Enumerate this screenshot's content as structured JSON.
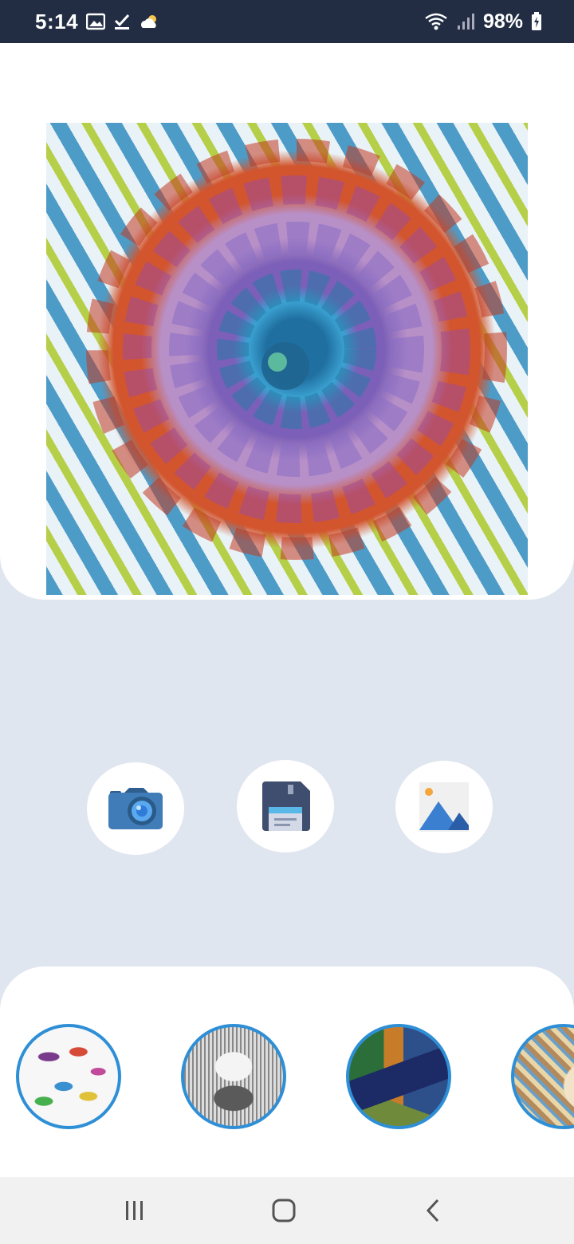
{
  "status_bar": {
    "time": "5:14",
    "battery": "98%",
    "left_icons": [
      "image-icon",
      "check-icon",
      "weather-cloud-sun-icon"
    ],
    "right_icons": [
      "wifi-icon",
      "signal-icon",
      "battery-charging-icon"
    ]
  },
  "main": {
    "artwork": {
      "icon": "stylized-flower-image"
    },
    "actions": [
      {
        "name": "camera",
        "icon": "camera-icon"
      },
      {
        "name": "save",
        "icon": "floppy-disk-icon"
      },
      {
        "name": "gallery",
        "icon": "image-gallery-icon"
      }
    ]
  },
  "styles": {
    "thumbnails": [
      {
        "icon": "watercolor-feathers-thumbnail"
      },
      {
        "icon": "pencil-cupcake-thumbnail"
      },
      {
        "icon": "cubist-painting-thumbnail"
      },
      {
        "icon": "mosaic-portrait-thumbnail"
      }
    ],
    "selected_border_color": "#2e8fd6"
  },
  "nav_bar": {
    "buttons": [
      "recent-apps-icon",
      "home-icon",
      "back-icon"
    ]
  },
  "colors": {
    "status_bar_bg": "#222d44",
    "page_bg": "#e0e6ef",
    "card_bg": "#ffffff",
    "nav_bg": "#f1f1f1"
  }
}
